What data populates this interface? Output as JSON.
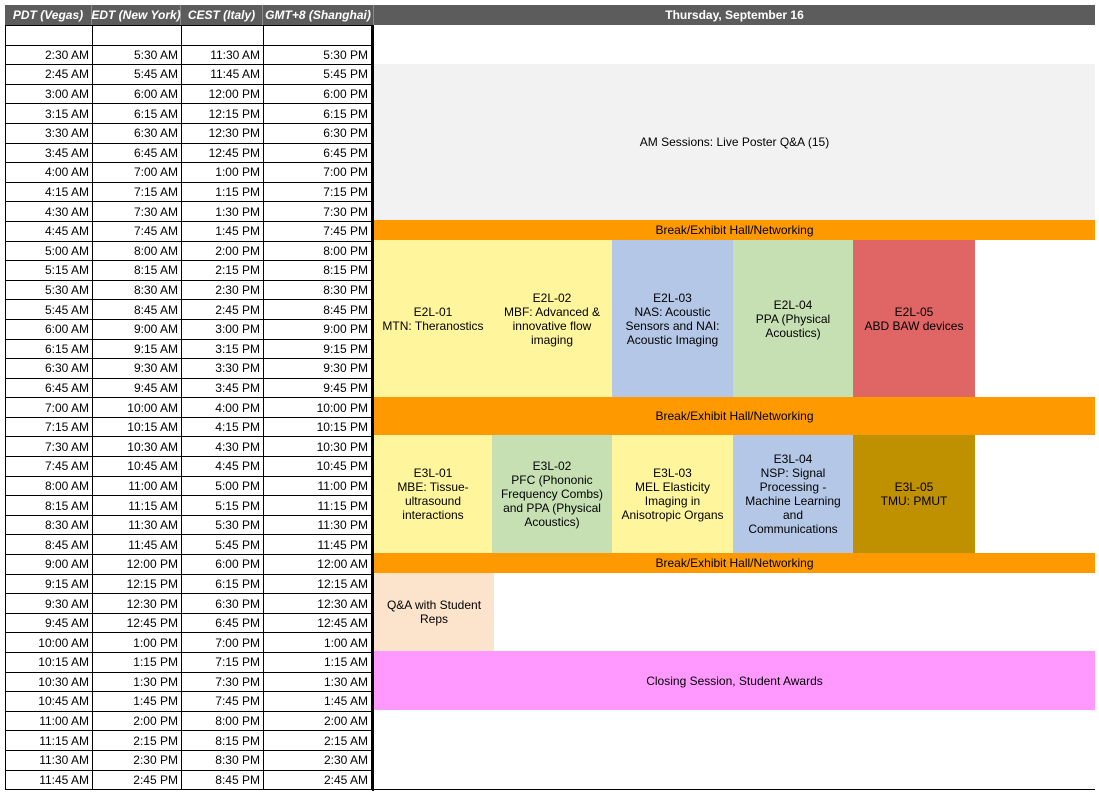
{
  "headers": {
    "pdt": "PDT (Vegas)",
    "edt": "EDT (New York)",
    "cest": "CEST (Italy)",
    "gmt8": "GMT+8 (Shanghai)",
    "day": "Thursday, September 16"
  },
  "rows": [
    [
      "",
      "",
      "",
      ""
    ],
    [
      "2:30 AM",
      "5:30 AM",
      "11:30 AM",
      "5:30 PM"
    ],
    [
      "2:45 AM",
      "5:45 AM",
      "11:45 AM",
      "5:45 PM"
    ],
    [
      "3:00 AM",
      "6:00 AM",
      "12:00 PM",
      "6:00 PM"
    ],
    [
      "3:15 AM",
      "6:15 AM",
      "12:15 PM",
      "6:15 PM"
    ],
    [
      "3:30 AM",
      "6:30 AM",
      "12:30 PM",
      "6:30 PM"
    ],
    [
      "3:45 AM",
      "6:45 AM",
      "12:45 PM",
      "6:45 PM"
    ],
    [
      "4:00 AM",
      "7:00 AM",
      "1:00 PM",
      "7:00 PM"
    ],
    [
      "4:15 AM",
      "7:15 AM",
      "1:15 PM",
      "7:15 PM"
    ],
    [
      "4:30 AM",
      "7:30 AM",
      "1:30 PM",
      "7:30 PM"
    ],
    [
      "4:45 AM",
      "7:45 AM",
      "1:45 PM",
      "7:45 PM"
    ],
    [
      "5:00 AM",
      "8:00 AM",
      "2:00 PM",
      "8:00 PM"
    ],
    [
      "5:15 AM",
      "8:15 AM",
      "2:15 PM",
      "8:15 PM"
    ],
    [
      "5:30 AM",
      "8:30 AM",
      "2:30 PM",
      "8:30 PM"
    ],
    [
      "5:45 AM",
      "8:45 AM",
      "2:45 PM",
      "8:45 PM"
    ],
    [
      "6:00 AM",
      "9:00 AM",
      "3:00 PM",
      "9:00 PM"
    ],
    [
      "6:15 AM",
      "9:15 AM",
      "3:15 PM",
      "9:15 PM"
    ],
    [
      "6:30 AM",
      "9:30 AM",
      "3:30 PM",
      "9:30 PM"
    ],
    [
      "6:45 AM",
      "9:45 AM",
      "3:45 PM",
      "9:45 PM"
    ],
    [
      "7:00 AM",
      "10:00 AM",
      "4:00 PM",
      "10:00 PM"
    ],
    [
      "7:15 AM",
      "10:15 AM",
      "4:15 PM",
      "10:15 PM"
    ],
    [
      "7:30 AM",
      "10:30 AM",
      "4:30 PM",
      "10:30 PM"
    ],
    [
      "7:45 AM",
      "10:45 AM",
      "4:45 PM",
      "10:45 PM"
    ],
    [
      "8:00 AM",
      "11:00 AM",
      "5:00 PM",
      "11:00 PM"
    ],
    [
      "8:15 AM",
      "11:15 AM",
      "5:15 PM",
      "11:15 PM"
    ],
    [
      "8:30 AM",
      "11:30 AM",
      "5:30 PM",
      "11:30 PM"
    ],
    [
      "8:45 AM",
      "11:45 AM",
      "5:45 PM",
      "11:45 PM"
    ],
    [
      "9:00 AM",
      "12:00 PM",
      "6:00 PM",
      "12:00 AM"
    ],
    [
      "9:15 AM",
      "12:15 PM",
      "6:15 PM",
      "12:15 AM"
    ],
    [
      "9:30 AM",
      "12:30 PM",
      "6:30 PM",
      "12:30 AM"
    ],
    [
      "9:45 AM",
      "12:45 PM",
      "6:45 PM",
      "12:45 AM"
    ],
    [
      "10:00 AM",
      "1:00 PM",
      "7:00 PM",
      "1:00 AM"
    ],
    [
      "10:15 AM",
      "1:15 PM",
      "7:15 PM",
      "1:15 AM"
    ],
    [
      "10:30 AM",
      "1:30 PM",
      "7:30 PM",
      "1:30 AM"
    ],
    [
      "10:45 AM",
      "1:45 PM",
      "7:45 PM",
      "1:45 AM"
    ],
    [
      "11:00 AM",
      "2:00 PM",
      "8:00 PM",
      "2:00 AM"
    ],
    [
      "11:15 AM",
      "2:15 PM",
      "8:15 PM",
      "2:15 AM"
    ],
    [
      "11:30 AM",
      "2:30 PM",
      "8:30 PM",
      "2:30 AM"
    ],
    [
      "11:45 AM",
      "2:45 PM",
      "8:45 PM",
      "2:45 AM"
    ]
  ],
  "sessions": {
    "am_poster": "AM Sessions: Live Poster Q&A (15)",
    "break1": "Break/Exhibit Hall/Networking",
    "e2l01": "E2L-01\nMTN: Theranostics",
    "e2l02": "E2L-02\nMBF: Advanced &\ninnovative flow\nimaging",
    "e2l03": "E2L-03\nNAS: Acoustic\nSensors and NAI:\nAcoustic Imaging",
    "e2l04": "E2L-04\nPPA (Physical\nAcoustics)",
    "e2l05": "E2L-05\nABD BAW devices",
    "break2": "Break/Exhibit Hall/Networking",
    "e3l01": "E3L-01\nMBE: Tissue-\nultrasound\ninteractions",
    "e3l02": "E3L-02\nPFC (Phononic\nFrequency Combs)\nand PPA (Physical\nAcoustics)",
    "e3l03": "E3L-03\nMEL Elasticity\nImaging in\nAnisotropic Organs",
    "e3l04": "E3L-04\nNSP: Signal\nProcessing -\nMachine Learning\nand\nCommunications",
    "e3l05": "E3L-05\nTMU: PMUT",
    "break3": "Break/Exhibit Hall/Networking",
    "qa_students": "Q&A with Student\nReps",
    "closing": "Closing Session, Student Awards"
  },
  "colors": {
    "header_bg": "#5c5c5c",
    "poster": "#f2f2f2",
    "break": "#ff9900",
    "yellow": "#fff59d",
    "blue": "#b4c7e7",
    "green": "#c6e0b4",
    "red": "#e06666",
    "gold": "#bf9000",
    "peach": "#fbe3cc",
    "pink": "#ff99ff"
  }
}
